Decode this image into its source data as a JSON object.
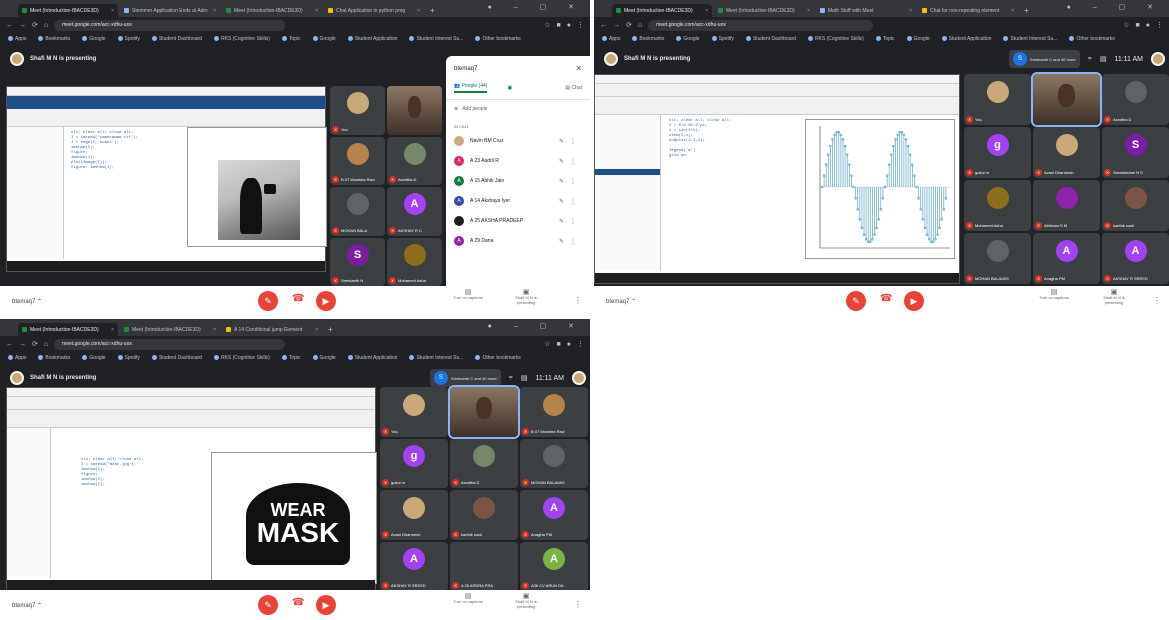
{
  "shots": [
    {
      "tabs": [
        "Meet (Introduction-IBACDE3D)",
        "Stemmer Application Ends at Adm",
        "Meet (Introduction-IBACDE3D)",
        "Chat Application in python prog"
      ],
      "url": "meet.google.com/acc-xdhu-uox",
      "bookmarks": [
        "Apps",
        "Bookmarks",
        "Google",
        "Spotify",
        "Student Dashboard",
        "RKS (Cognitive Skills)",
        "Topic",
        "Google",
        "Student Application",
        "Student Interest Su...",
        "Other bookmarks"
      ],
      "presenter": "Shafi M N is presenting",
      "meeting_name": "btemaq7",
      "participants": [
        {
          "name": "You",
          "initial": "",
          "color": "#c9a97a"
        },
        {
          "name": "B 07 Monisha Ravi",
          "initial": "",
          "color": "#b5834b"
        },
        {
          "name": "Asmitha D",
          "initial": "",
          "color": "#78866b"
        },
        {
          "name": "MOHAN BALA",
          "initial": "",
          "color": "#5f6368"
        },
        {
          "name": "AKSHAY R C",
          "initial": "A",
          "color": "#a142f4"
        },
        {
          "name": "Sreekanth N",
          "initial": "S",
          "color": "#7b1fa2"
        },
        {
          "name": "Mohamed Asha",
          "initial": "",
          "color": "#8d6e1f"
        }
      ],
      "people_panel": {
        "title": "btemaq7",
        "tab_people": "People (44)",
        "tab_chat": "Chat",
        "add_people": "Add people",
        "section": "IN CALL",
        "rows": [
          {
            "name": "Navin BM Cruz",
            "initial": "",
            "color": "#c9a97a"
          },
          {
            "name": "A 23 Aadril R",
            "initial": "A",
            "color": "#e91e63"
          },
          {
            "name": "A 15 Abhik Jain",
            "initial": "A",
            "color": "#0b8043"
          },
          {
            "name": "A 14 Akshaya Iyer",
            "initial": "A",
            "color": "#3949ab"
          },
          {
            "name": "A 25 AKSHA PRADEEP",
            "initial": "",
            "color": "#202124"
          },
          {
            "name": "A 29 Dana",
            "initial": "A",
            "color": "#8e24aa"
          }
        ]
      },
      "captions_label": "Turn on captions",
      "present_label": "Shafi M N is presenting",
      "code": "clc; clear all; close all;\nI = imread('cameraman.tif');\nJ = edge(I,'sobel');\nimshow(I);\nfigure;\nimshow(J);\nplot(Image(I));\nfigure; imshow(J);"
    },
    {
      "tabs": [
        "Meet (Introduction-IBACDE3D)",
        "Meet (Introduction-IBACDE3D)",
        "Math Stuff with Meet",
        "Chat for non-repeating element"
      ],
      "url": "meet.google.com/acc-xdhu-uox",
      "bookmarks": [
        "Apps",
        "Bookmarks",
        "Google",
        "Spotify",
        "Student Dashboard",
        "RKS (Cognitive Skills)",
        "Topic",
        "Google",
        "Student Application",
        "Student Interest Su...",
        "Other bookmarks"
      ],
      "presenter": "Shafi M N is presenting",
      "meeting_name": "btemaq7",
      "joined": "Sreekanth C and 40 more",
      "time": "11:11 AM",
      "captions_label": "Turn on captions",
      "present_label": "Shafi M N is presenting",
      "code": "clc; clear all; close all;\nt = 0:0.01:2*pi;\nx = sin(2*t);\nstem(t,x);\nsubplot(2,1,1);\n\nlegend('a')\ngrid on",
      "participants": [
        {
          "name": "You",
          "initial": "",
          "color": "#c9a97a"
        },
        {
          "name": "Shafi M N",
          "initial": "",
          "color": "#6d4c41",
          "video": true
        },
        {
          "name": "Asmitha D",
          "initial": "",
          "color": "#5f6368"
        },
        {
          "name": "gokul m",
          "initial": "g",
          "color": "#a142f4"
        },
        {
          "name": "Avani Dharmesh",
          "initial": "",
          "color": "#c9a97a"
        },
        {
          "name": "Sreelakshmi N S",
          "initial": "S",
          "color": "#7b1fa2"
        },
        {
          "name": "Mohamed Asha",
          "initial": "",
          "color": "#8d6e1f"
        },
        {
          "name": "Abhiram S M",
          "initial": "",
          "color": "#8e24aa"
        },
        {
          "name": "karthik sunil",
          "initial": "",
          "color": "#795548"
        },
        {
          "name": "MOHAN BALAVAS",
          "initial": "",
          "color": "#5f6368"
        },
        {
          "name": "Anagha PM",
          "initial": "A",
          "color": "#a142f4"
        },
        {
          "name": "AKSHAY R SREED",
          "initial": "A",
          "color": "#a142f4"
        }
      ]
    },
    {
      "tabs": [
        "Meet (Introduction-IBACDE3D)",
        "Meet (Introduction-IBACDE3D)",
        "A 14 Conditional jump Element"
      ],
      "url": "meet.google.com/acc-xdhu-uox",
      "bookmarks": [
        "Apps",
        "Bookmarks",
        "Google",
        "Spotify",
        "Student Dashboard",
        "RKS (Cognitive Skills)",
        "Topic",
        "Google",
        "Student Application",
        "Student Interest Su...",
        "Other bookmarks"
      ],
      "presenter": "Shafi M N is presenting",
      "meeting_name": "btemaq7",
      "joined": "Sreekanth C and 40 more",
      "time": "11:11 AM",
      "captions_label": "Turn on captions",
      "present_label": "Shafi M N is presenting",
      "mask_text_1": "WEAR",
      "mask_text_2": "MASK",
      "code": "clc; clear all; close all;\nI = imread('mask.jpg');\nimshow(I);\nfigure;\nimshow(I);\nimshow(I);",
      "participants": [
        {
          "name": "You",
          "initial": "",
          "color": "#c9a97a"
        },
        {
          "name": "Shafi M N",
          "initial": "",
          "color": "#6d4c41",
          "video": true
        },
        {
          "name": "B 07 Monisha Ravi",
          "initial": "",
          "color": "#b5834b"
        },
        {
          "name": "gokul m",
          "initial": "g",
          "color": "#a142f4"
        },
        {
          "name": "Asmitha D",
          "initial": "",
          "color": "#78866b"
        },
        {
          "name": "MOHAN BALAVAS",
          "initial": "",
          "color": "#5f6368"
        },
        {
          "name": "Avani Dharmesh",
          "initial": "",
          "color": "#c9a97a"
        },
        {
          "name": "karthik sunil",
          "initial": "",
          "color": "#795548"
        },
        {
          "name": "Anagha PM",
          "initial": "A",
          "color": "#a142f4"
        },
        {
          "name": "AKSHAY R SREED",
          "initial": "A",
          "color": "#a142f4"
        },
        {
          "name": "A 25 ARDRA PRA",
          "initial": "",
          "color": "#3c4043"
        },
        {
          "name": "A36 CV ARUN DA",
          "initial": "A",
          "color": "#7cb342"
        }
      ]
    }
  ]
}
